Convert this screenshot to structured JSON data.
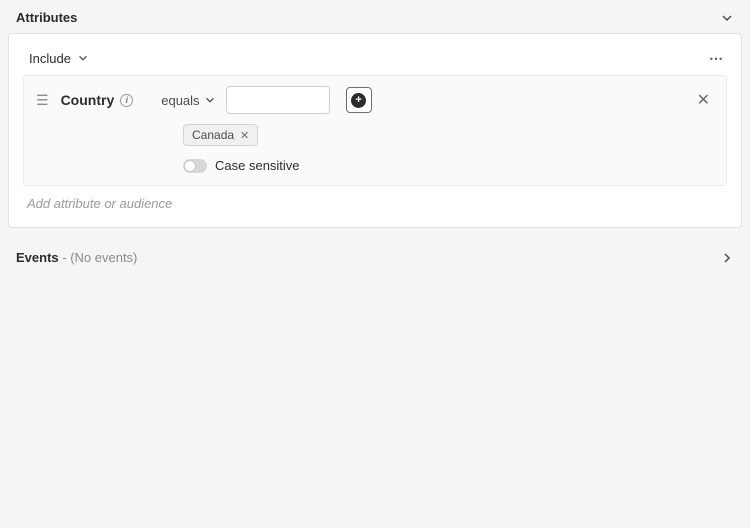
{
  "panels": {
    "attributes": {
      "title": "Attributes"
    },
    "events": {
      "title": "Events",
      "suffix": " - (No events)"
    }
  },
  "includeGroup": {
    "label": "Include"
  },
  "rule": {
    "attribute_name": "Country",
    "operator": "equals",
    "value": "",
    "value_placeholder": "",
    "tags": [
      {
        "label": "Canada"
      }
    ],
    "case_sensitive_label": "Case sensitive"
  },
  "actions": {
    "add_attribute_link": "Add attribute or audience"
  }
}
